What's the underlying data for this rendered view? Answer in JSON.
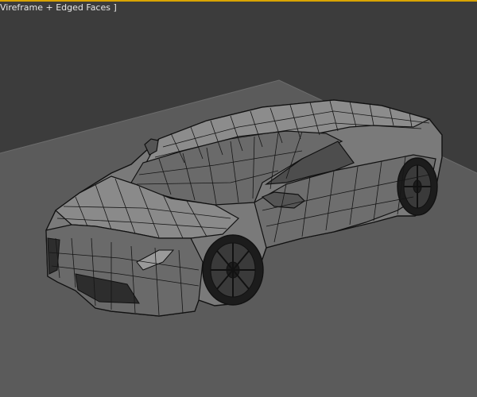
{
  "viewport": {
    "label": "Vireframe + Edged Faces ]",
    "active_border_color": "#d9a400",
    "background_color": "#3c3c3c",
    "ground_color": "#5a5a5a"
  },
  "scene": {
    "object": "car-model",
    "display_mode": "wireframe-edged-faces"
  }
}
